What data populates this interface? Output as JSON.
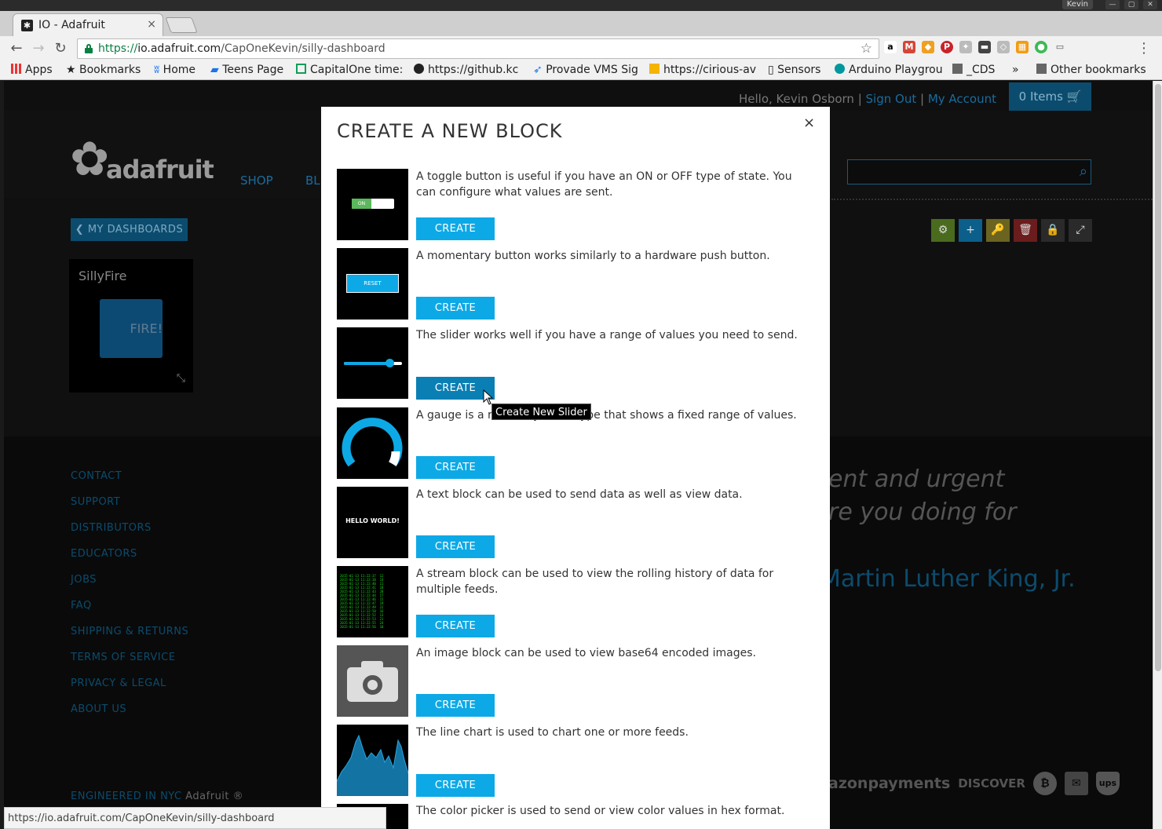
{
  "window": {
    "user": "Kevin",
    "controls": [
      "—",
      "▢",
      "✕"
    ]
  },
  "tab": {
    "title": "IO - Adafruit",
    "favicon": "✱",
    "close": "×"
  },
  "toolbar": {
    "url_scheme": "https://",
    "url_host": "io.adafruit.com",
    "url_path": "/CapOneKevin/silly-dashboard",
    "back": "←",
    "forward": "→",
    "reload": "↻",
    "star": "☆",
    "menu": "⋮"
  },
  "bookmarks": {
    "apps": "Apps",
    "bookmarks": "Bookmarks",
    "home": "Home",
    "teens": "Teens Page",
    "capitalone": "CapitalOne time:",
    "github": "https://github.kc",
    "provade": "Provade VMS Sig",
    "cirious": "https://cirious-av",
    "sensors": "Sensors",
    "arduino": "Arduino Playgrou",
    "cds": "_CDS",
    "overflow": "»",
    "other": "Other bookmarks"
  },
  "header": {
    "hello": "Hello, Kevin Osborn |",
    "sign_out": "Sign Out",
    "sep": "|",
    "my_account": "My Account",
    "cart": "0 Items 🛒",
    "logo": "adafruit",
    "nav_shop": "SHOP",
    "nav_blog": "BL"
  },
  "dashboard": {
    "my_dashboards": "❮ MY DASHBOARDS",
    "block_title": "SillyFire",
    "fire_label": "FIRE!",
    "tools": [
      "⚙",
      "+",
      "🔑",
      "🗑",
      "🔒",
      "⤢"
    ]
  },
  "footer": {
    "links": [
      "CONTACT",
      "SUPPORT",
      "DISTRIBUTORS",
      "EDUCATORS",
      "JOBS",
      "FAQ",
      "SHIPPING & RETURNS",
      "TERMS OF SERVICE",
      "PRIVACY & LEGAL",
      "ABOUT US"
    ],
    "quote_line1": "ent and urgent",
    "quote_line2": "re you doing for",
    "quote_author": "Martin Luther King, Jr.",
    "engineered": "ENGINEERED IN NYC",
    "engineered_brand": "Adafruit ®",
    "payments_amazon": "azonpayments",
    "payments_discover": "DISCOVER",
    "payments_btc": "₿",
    "payments_ups": "ups"
  },
  "status_url": "https://io.adafruit.com/CapOneKevin/silly-dashboard",
  "modal": {
    "title": "CREATE A NEW BLOCK",
    "close": "×",
    "create_label": "CREATE",
    "options": [
      {
        "desc": "A toggle button is useful if you have an ON or OFF type of state. You can configure what values are sent.",
        "thumb_text": "ON"
      },
      {
        "desc": "A momentary button works similarly to a hardware push button.",
        "thumb_text": "RESET"
      },
      {
        "desc": "The slider works well if you have a range of values you need to send.",
        "thumb_text": ""
      },
      {
        "desc": "A gauge is a read-only block type that shows a fixed range of values.",
        "thumb_text": ""
      },
      {
        "desc": "A text block can be used to send data as well as view data.",
        "thumb_text": "HELLO WORLD!"
      },
      {
        "desc": "A stream block can be used to view the rolling history of data for multiple feeds.",
        "thumb_text": ""
      },
      {
        "desc": "An image block can be used to view base64 encoded images.",
        "thumb_text": ""
      },
      {
        "desc": "The line chart is used to chart one or more feeds.",
        "thumb_text": ""
      }
    ],
    "partial_desc": "The color picker is used to send or view color values in hex format.",
    "tooltip": "Create New Slider"
  },
  "colors": {
    "accent": "#0da9e6",
    "accent_hover": "#0a7fb4",
    "site_blue": "#0b4c6e"
  }
}
